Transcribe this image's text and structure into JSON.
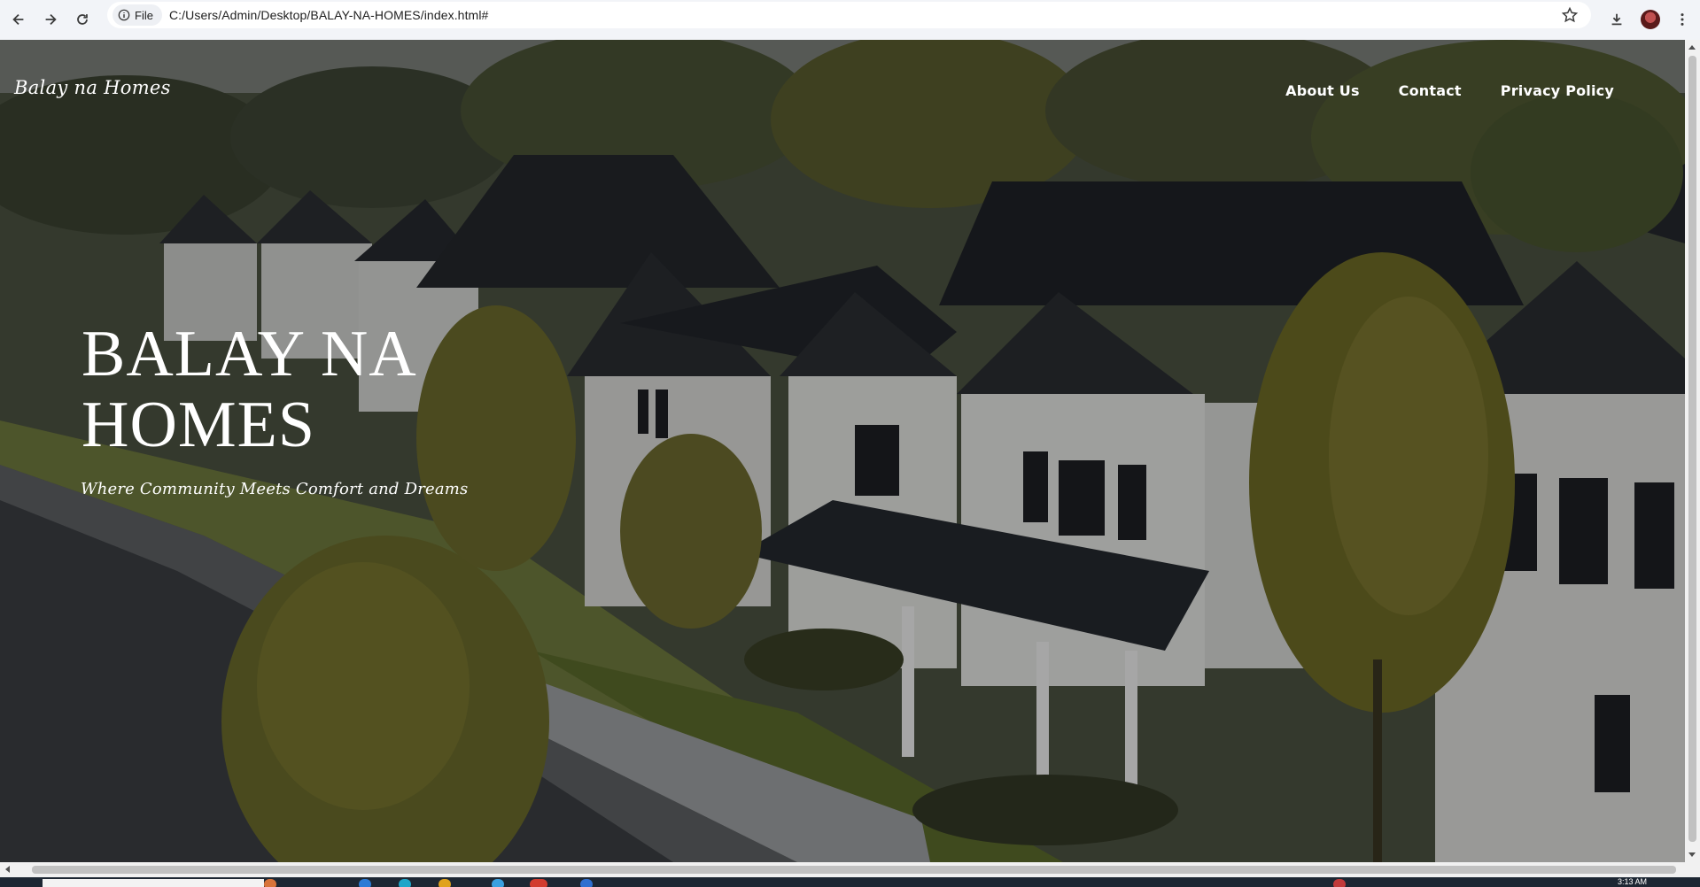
{
  "browser": {
    "file_chip": "File",
    "url": "C:/Users/Admin/Desktop/BALAY-NA-HOMES/index.html#"
  },
  "site": {
    "logo": "Balay na Homes",
    "nav": [
      "About Us",
      "Contact",
      "Privacy Policy"
    ],
    "hero_title_line1": "BALAY NA",
    "hero_title_line2": "HOMES",
    "tagline": "Where Community Meets Comfort and Dreams"
  },
  "taskbar": {
    "time": "3:13 AM"
  },
  "colors": {
    "chrome_bg": "#f2f4f8",
    "hero_text": "#ffffff",
    "roof": "#23262c",
    "siding": "#e9eaea",
    "foliage": "#6b6a2a"
  }
}
